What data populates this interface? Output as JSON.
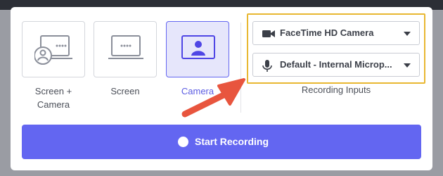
{
  "modes": [
    {
      "label": "Screen +\nCamera",
      "icon": "screen-camera-icon",
      "selected": false
    },
    {
      "label": "Screen",
      "icon": "screen-icon",
      "selected": false
    },
    {
      "label": "Camera",
      "icon": "camera-icon",
      "selected": true
    }
  ],
  "inputs": {
    "camera_value": "FaceTime HD Camera",
    "microphone_value": "Default - Internal Microp...",
    "section_label": "Recording Inputs"
  },
  "record_button": {
    "label": "Start Recording"
  },
  "colors": {
    "accent": "#6366f1",
    "selected_bg": "#e6e6fb",
    "highlight_border": "#e8b731",
    "arrow": "#e8553e"
  }
}
